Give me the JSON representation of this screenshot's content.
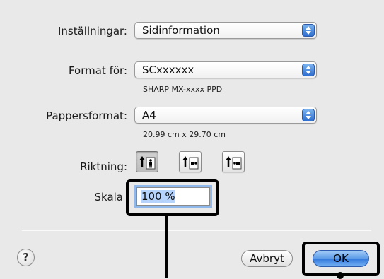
{
  "settings": {
    "label": "Inställningar:",
    "value": "Sidinformation"
  },
  "format": {
    "label": "Format för:",
    "value": "SCxxxxxx",
    "detail": "SHARP MX-xxxx PPD"
  },
  "paper": {
    "label": "Pappersformat:",
    "value": "A4",
    "detail": "20.99 cm x 29.70 cm"
  },
  "orientation": {
    "label": "Riktning:"
  },
  "scale": {
    "label": "Skala",
    "value": "100 %"
  },
  "buttons": {
    "help": "?",
    "cancel": "Avbryt",
    "ok": "OK"
  },
  "colors": {
    "accent": "#2f76db",
    "focus_ring": "#8fb8ec",
    "callout": "#000000"
  }
}
